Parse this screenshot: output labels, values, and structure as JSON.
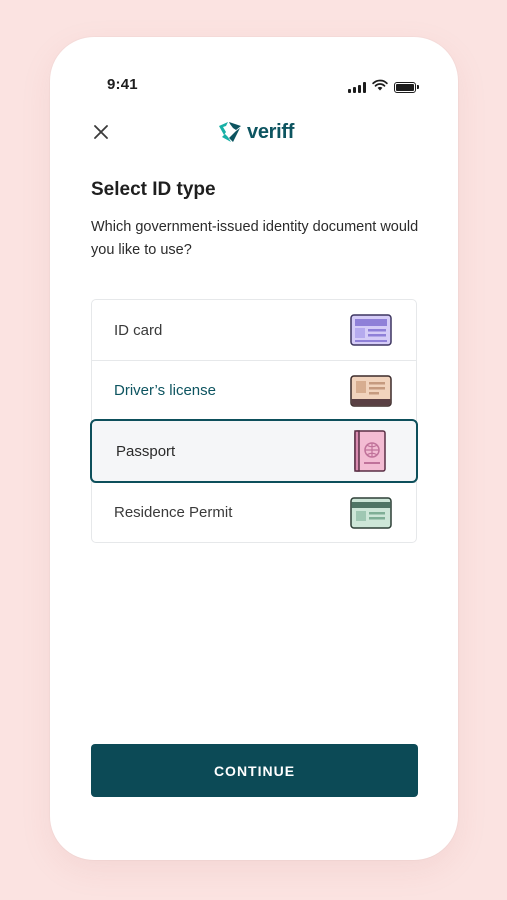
{
  "status_bar": {
    "time": "9:41",
    "icons": [
      "signal-icon",
      "wifi-icon",
      "battery-icon"
    ]
  },
  "header": {
    "close_icon": "close-icon",
    "logo_text": "veriff"
  },
  "title": "Select ID type",
  "subtitle": "Which government-issued identity document would you like to use?",
  "documents": [
    {
      "label": "ID card",
      "icon": "id-card-icon",
      "selected": false
    },
    {
      "label": "Driver’s license",
      "icon": "drivers-license-icon",
      "selected": false
    },
    {
      "label": "Passport",
      "icon": "passport-icon",
      "selected": true
    },
    {
      "label": "Residence Permit",
      "icon": "residence-permit-icon",
      "selected": false
    }
  ],
  "continue_label": "CONTINUE",
  "colors": {
    "background": "#fbe3e1",
    "brand": "#0c4a56",
    "selected_border": "#0d4f5b",
    "link_text": "#0d5460"
  }
}
